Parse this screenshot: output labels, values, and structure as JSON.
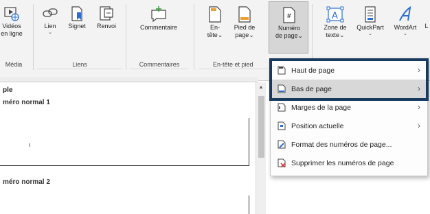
{
  "ribbon": {
    "media": {
      "line1": "Vidéos",
      "line2": "en ligne",
      "group_label": "Média"
    },
    "links": {
      "lien": "Lien",
      "signet": "Signet",
      "renvoi": "Renvoi",
      "group_label": "Liens"
    },
    "comments": {
      "commentaire": "Commentaire",
      "group_label": "Commentaires"
    },
    "header_footer": {
      "entete_line1": "En-",
      "entete_line2": "tête",
      "pied_line1": "Pied de",
      "pied_line2": "page",
      "numero_line1": "Numéro",
      "numero_line2": "de page",
      "group_label": "En-tête et pied"
    },
    "text": {
      "zone_line1": "Zone de",
      "zone_line2": "texte",
      "quickpart": "QuickPart",
      "wordart": "WordArt",
      "extra": "L"
    },
    "caret": "⌄"
  },
  "document": {
    "title": "ple",
    "heading1": "méro normal 1",
    "heading2": "méro normal 2",
    "mark": "ı"
  },
  "menu": {
    "items": [
      {
        "label": "Haut de page",
        "has_submenu": true,
        "icon": "page-top-icon"
      },
      {
        "label": "Bas de page",
        "has_submenu": true,
        "icon": "page-bottom-icon"
      },
      {
        "label": "Marges de la page",
        "has_submenu": true,
        "icon": "page-margins-icon"
      },
      {
        "label": "Position actuelle",
        "has_submenu": true,
        "icon": "current-position-icon"
      },
      {
        "label": "Format des numéros de page...",
        "has_submenu": false,
        "icon": "format-page-numbers-icon"
      },
      {
        "label": "Supprimer les numéros de page",
        "has_submenu": false,
        "icon": "remove-page-numbers-icon"
      }
    ],
    "chevron": "›"
  },
  "colors": {
    "highlight_border": "#183a5e",
    "wordart_blue": "#2b6fd6",
    "bookmark_blue": "#2a6ccf",
    "comment_green": "#3c9a3c",
    "footer_orange": "#e8a23a",
    "delete_red": "#d13b3b"
  }
}
